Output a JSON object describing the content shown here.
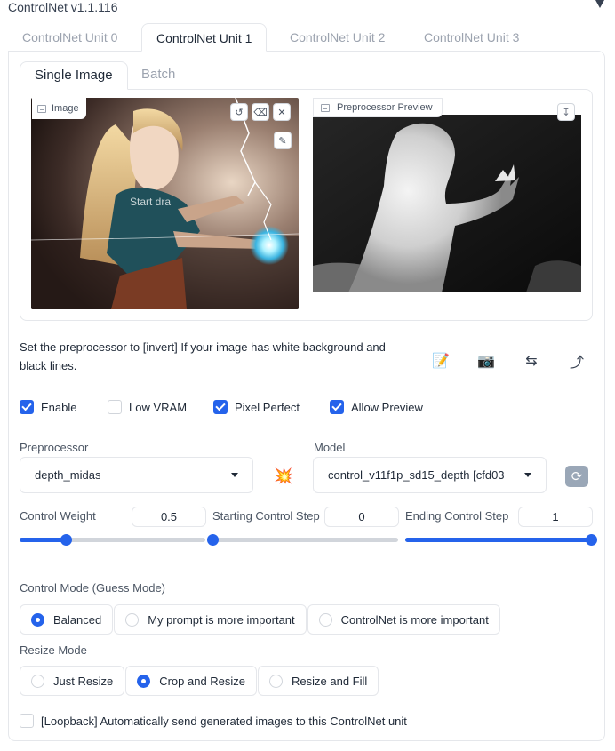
{
  "header": {
    "title": "ControlNet v1.1.116"
  },
  "unit_tabs": [
    "ControlNet Unit 0",
    "ControlNet Unit 1",
    "ControlNet Unit 2",
    "ControlNet Unit 3"
  ],
  "active_unit_tab": 1,
  "sub_tabs": [
    "Single Image",
    "Batch"
  ],
  "active_sub_tab": 0,
  "image_panel": {
    "image_label": "Image",
    "start_text": "Start dra",
    "preview_label": "Preprocessor Preview"
  },
  "info_text": "Set the preprocessor to [invert] If your image has white background and black lines.",
  "icons": {
    "notepad": "notepad-icon",
    "camera": "camera-icon",
    "swap": "swap-icon",
    "upload": "upload-arrow-icon",
    "explode": "explosion-icon",
    "refresh": "refresh-icon"
  },
  "checkboxes": [
    {
      "label": "Enable",
      "checked": true
    },
    {
      "label": "Low VRAM",
      "checked": false
    },
    {
      "label": "Pixel Perfect",
      "checked": true
    },
    {
      "label": "Allow Preview",
      "checked": true
    }
  ],
  "preprocessor": {
    "label": "Preprocessor",
    "value": "depth_midas"
  },
  "model": {
    "label": "Model",
    "value": "control_v11f1p_sd15_depth [cfd03"
  },
  "sliders": [
    {
      "label": "Control Weight",
      "value": "0.5",
      "fraction": 0.25
    },
    {
      "label": "Starting Control Step",
      "value": "0",
      "fraction": 0.0
    },
    {
      "label": "Ending Control Step",
      "value": "1",
      "fraction": 1.0
    }
  ],
  "control_mode": {
    "label": "Control Mode (Guess Mode)",
    "options": [
      "Balanced",
      "My prompt is more important",
      "ControlNet is more important"
    ],
    "selected": 0
  },
  "resize_mode": {
    "label": "Resize Mode",
    "options": [
      "Just Resize",
      "Crop and Resize",
      "Resize and Fill"
    ],
    "selected": 1
  },
  "loopback": {
    "label": "[Loopback] Automatically send generated images to this ControlNet unit",
    "checked": false
  },
  "colors": {
    "accent": "#2563eb",
    "border": "#e5e7eb"
  }
}
